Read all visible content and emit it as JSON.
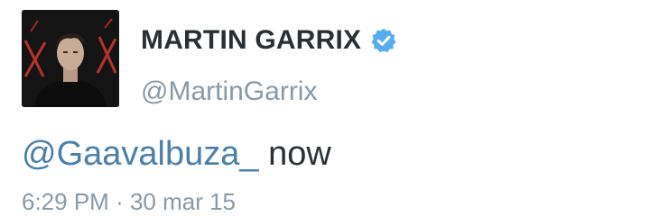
{
  "author": {
    "display_name": "MARTIN GARRIX",
    "handle": "@MartinGarrix",
    "verified_icon": "verified-badge-icon",
    "verified_color": "#55acee"
  },
  "tweet": {
    "mention": "@Gaavalbuza_",
    "text_after_mention": " now",
    "time": "6:29 PM",
    "separator": " · ",
    "date": "30 mar 15"
  },
  "colors": {
    "mention": "#4a7fa8",
    "secondary_text": "#8899a6",
    "primary_text": "#292f33"
  }
}
